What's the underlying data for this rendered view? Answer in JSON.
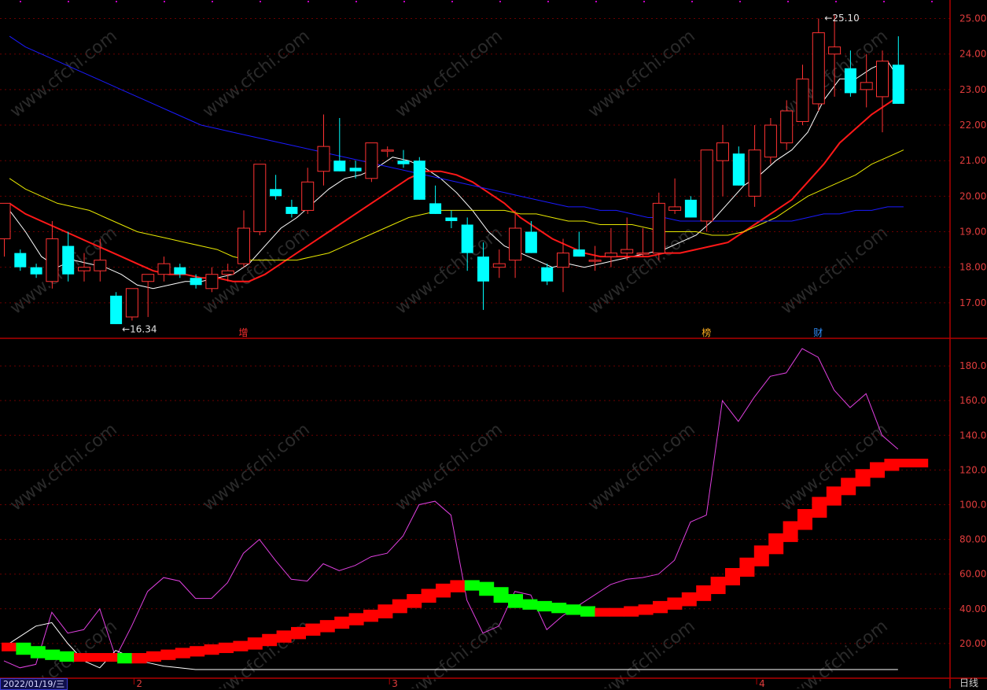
{
  "chart_data": [
    {
      "panel": "price",
      "type": "candlestick",
      "y_axis_ticks": [
        "25.00",
        "24.00",
        "23.00",
        "22.00",
        "21.00",
        "20.00",
        "19.00",
        "18.00",
        "17.00"
      ],
      "ylim": [
        16.0,
        25.3
      ],
      "candles": [
        {
          "o": 18.8,
          "h": 19.7,
          "l": 18.3,
          "c": 19.8
        },
        {
          "o": 18.4,
          "h": 18.5,
          "l": 17.9,
          "c": 18.0
        },
        {
          "o": 18.0,
          "h": 18.1,
          "l": 17.7,
          "c": 17.8
        },
        {
          "o": 17.6,
          "h": 19.3,
          "l": 17.4,
          "c": 18.8
        },
        {
          "o": 18.6,
          "h": 19.0,
          "l": 17.6,
          "c": 17.8
        },
        {
          "o": 17.9,
          "h": 18.4,
          "l": 17.6,
          "c": 18.0
        },
        {
          "o": 17.9,
          "h": 18.8,
          "l": 17.6,
          "c": 18.2
        },
        {
          "o": 17.2,
          "h": 17.3,
          "l": 16.4,
          "c": 16.4
        },
        {
          "o": 16.6,
          "h": 17.4,
          "l": 16.5,
          "c": 17.4
        },
        {
          "o": 17.6,
          "h": 17.8,
          "l": 16.6,
          "c": 17.8
        },
        {
          "o": 17.8,
          "h": 18.3,
          "l": 17.6,
          "c": 18.1
        },
        {
          "o": 18.0,
          "h": 18.1,
          "l": 17.7,
          "c": 17.8
        },
        {
          "o": 17.7,
          "h": 17.8,
          "l": 17.4,
          "c": 17.5
        },
        {
          "o": 17.4,
          "h": 18.0,
          "l": 17.3,
          "c": 17.8
        },
        {
          "o": 17.8,
          "h": 18.1,
          "l": 17.6,
          "c": 17.9
        },
        {
          "o": 18.1,
          "h": 19.6,
          "l": 18.0,
          "c": 19.1
        },
        {
          "o": 19.0,
          "h": 20.9,
          "l": 18.9,
          "c": 20.9
        },
        {
          "o": 20.2,
          "h": 20.6,
          "l": 19.9,
          "c": 20.0
        },
        {
          "o": 19.7,
          "h": 19.9,
          "l": 19.4,
          "c": 19.5
        },
        {
          "o": 19.6,
          "h": 20.8,
          "l": 19.5,
          "c": 20.4
        },
        {
          "o": 20.7,
          "h": 22.3,
          "l": 20.3,
          "c": 21.4
        },
        {
          "o": 21.0,
          "h": 22.2,
          "l": 20.7,
          "c": 20.7
        },
        {
          "o": 20.8,
          "h": 21.0,
          "l": 20.5,
          "c": 20.7
        },
        {
          "o": 20.5,
          "h": 21.5,
          "l": 20.4,
          "c": 21.5
        },
        {
          "o": 21.3,
          "h": 21.4,
          "l": 21.1,
          "c": 21.3
        },
        {
          "o": 21.0,
          "h": 21.3,
          "l": 20.8,
          "c": 20.9
        },
        {
          "o": 21.0,
          "h": 21.1,
          "l": 19.9,
          "c": 19.9
        },
        {
          "o": 19.8,
          "h": 20.3,
          "l": 19.5,
          "c": 19.5
        },
        {
          "o": 19.4,
          "h": 19.6,
          "l": 19.1,
          "c": 19.3
        },
        {
          "o": 19.2,
          "h": 19.4,
          "l": 17.9,
          "c": 18.4
        },
        {
          "o": 18.3,
          "h": 18.7,
          "l": 16.8,
          "c": 17.6
        },
        {
          "o": 18.0,
          "h": 18.5,
          "l": 17.7,
          "c": 18.1
        },
        {
          "o": 18.2,
          "h": 19.6,
          "l": 17.7,
          "c": 19.1
        },
        {
          "o": 19.0,
          "h": 19.3,
          "l": 18.4,
          "c": 18.4
        },
        {
          "o": 18.0,
          "h": 18.1,
          "l": 17.5,
          "c": 17.6
        },
        {
          "o": 18.0,
          "h": 18.8,
          "l": 17.3,
          "c": 18.4
        },
        {
          "o": 18.5,
          "h": 19.0,
          "l": 18.3,
          "c": 18.3
        },
        {
          "o": 18.2,
          "h": 18.6,
          "l": 17.9,
          "c": 18.2
        },
        {
          "o": 18.3,
          "h": 19.1,
          "l": 18.0,
          "c": 18.4
        },
        {
          "o": 18.4,
          "h": 19.4,
          "l": 18.2,
          "c": 18.5
        },
        {
          "o": 18.4,
          "h": 19.1,
          "l": 18.3,
          "c": 18.4
        },
        {
          "o": 18.4,
          "h": 20.1,
          "l": 18.2,
          "c": 19.8
        },
        {
          "o": 19.6,
          "h": 20.5,
          "l": 19.5,
          "c": 19.7
        },
        {
          "o": 19.9,
          "h": 20.0,
          "l": 19.4,
          "c": 19.4
        },
        {
          "o": 19.3,
          "h": 21.3,
          "l": 19.0,
          "c": 21.3
        },
        {
          "o": 21.0,
          "h": 22.0,
          "l": 20.0,
          "c": 21.5
        },
        {
          "o": 21.2,
          "h": 21.4,
          "l": 20.3,
          "c": 20.3
        },
        {
          "o": 20.0,
          "h": 22.0,
          "l": 19.7,
          "c": 21.3
        },
        {
          "o": 21.1,
          "h": 22.2,
          "l": 20.9,
          "c": 22.0
        },
        {
          "o": 21.5,
          "h": 22.7,
          "l": 21.3,
          "c": 22.4
        },
        {
          "o": 22.1,
          "h": 23.7,
          "l": 22.0,
          "c": 23.3
        },
        {
          "o": 22.6,
          "h": 25.0,
          "l": 22.4,
          "c": 24.6
        },
        {
          "o": 24.0,
          "h": 25.1,
          "l": 22.8,
          "c": 24.2
        },
        {
          "o": 23.6,
          "h": 24.1,
          "l": 22.8,
          "c": 22.9
        },
        {
          "o": 23.0,
          "h": 24.0,
          "l": 22.5,
          "c": 23.2
        },
        {
          "o": 22.8,
          "h": 24.1,
          "l": 21.8,
          "c": 23.8
        },
        {
          "o": 23.7,
          "h": 24.5,
          "l": 22.6,
          "c": 22.6
        }
      ],
      "ma_lines": [
        {
          "color": "#ffffff",
          "values": [
            19.6,
            19.0,
            18.3,
            18.0,
            18.2,
            18.1,
            18.0,
            17.8,
            17.5,
            17.4,
            17.5,
            17.6,
            17.6,
            17.7,
            17.8,
            18.1,
            18.6,
            19.1,
            19.4,
            19.8,
            20.2,
            20.5,
            20.6,
            20.8,
            21.1,
            21.0,
            20.8,
            20.5,
            20.1,
            19.6,
            19.0,
            18.6,
            18.4,
            18.2,
            18.0,
            18.1,
            18.0,
            18.1,
            18.2,
            18.3,
            18.4,
            18.5,
            18.7,
            18.9,
            19.3,
            19.8,
            20.3,
            20.6,
            21.0,
            21.3,
            21.8,
            22.7,
            23.3,
            23.3,
            23.6,
            23.8,
            23.1
          ]
        },
        {
          "color": "#ff1818",
          "values": [
            19.8,
            19.5,
            19.3,
            19.1,
            18.9,
            18.7,
            18.5,
            18.3,
            18.1,
            17.9,
            17.8,
            17.8,
            17.7,
            17.7,
            17.6,
            17.6,
            17.8,
            18.1,
            18.4,
            18.7,
            19.0,
            19.3,
            19.6,
            19.9,
            20.2,
            20.5,
            20.7,
            20.7,
            20.6,
            20.4,
            20.1,
            19.8,
            19.4,
            19.1,
            18.8,
            18.6,
            18.4,
            18.3,
            18.3,
            18.3,
            18.3,
            18.4,
            18.4,
            18.5,
            18.6,
            18.7,
            19.0,
            19.3,
            19.6,
            19.9,
            20.4,
            20.9,
            21.5,
            21.9,
            22.3,
            22.6,
            22.9
          ]
        },
        {
          "color": "#e8e800",
          "values": [
            20.5,
            20.2,
            20.0,
            19.8,
            19.7,
            19.6,
            19.4,
            19.2,
            19.0,
            18.9,
            18.8,
            18.7,
            18.6,
            18.5,
            18.3,
            18.2,
            18.2,
            18.2,
            18.2,
            18.3,
            18.4,
            18.6,
            18.8,
            19.0,
            19.2,
            19.4,
            19.5,
            19.6,
            19.6,
            19.6,
            19.6,
            19.6,
            19.5,
            19.5,
            19.4,
            19.3,
            19.3,
            19.2,
            19.2,
            19.2,
            19.1,
            19.0,
            19.0,
            19.0,
            18.9,
            18.9,
            19.0,
            19.2,
            19.4,
            19.7,
            20.0,
            20.2,
            20.4,
            20.6,
            20.9,
            21.1,
            21.3
          ]
        },
        {
          "color": "#1a1aff",
          "values": [
            24.5,
            24.2,
            24.0,
            23.8,
            23.6,
            23.4,
            23.2,
            23.0,
            22.8,
            22.6,
            22.4,
            22.2,
            22.0,
            21.9,
            21.8,
            21.7,
            21.6,
            21.5,
            21.4,
            21.3,
            21.2,
            21.1,
            21.0,
            20.9,
            20.8,
            20.7,
            20.6,
            20.5,
            20.4,
            20.3,
            20.2,
            20.1,
            20.0,
            19.9,
            19.8,
            19.7,
            19.7,
            19.6,
            19.6,
            19.5,
            19.4,
            19.4,
            19.3,
            19.3,
            19.3,
            19.3,
            19.3,
            19.3,
            19.3,
            19.3,
            19.4,
            19.5,
            19.5,
            19.6,
            19.6,
            19.7,
            19.7
          ]
        }
      ],
      "annotations": [
        {
          "text": "16.34",
          "index": 7,
          "value": 16.34,
          "color": "#e0e0e0"
        },
        {
          "text": "25.10",
          "index": 51,
          "value": 25.1,
          "color": "#e0e0e0"
        }
      ],
      "event_markers": [
        {
          "text": "增",
          "index": 15,
          "color": "#ff3030"
        },
        {
          "text": "榜",
          "index": 44,
          "color": "#ffb020"
        },
        {
          "text": "财",
          "index": 51,
          "color": "#3090ff"
        }
      ]
    },
    {
      "panel": "indicator",
      "type": "line",
      "y_axis_ticks": [
        "180.00",
        "160.00",
        "140.00",
        "120.00",
        "100.00",
        "80.00",
        "60.00",
        "40.00",
        "20.00"
      ],
      "ylim": [
        0,
        195
      ],
      "series": [
        {
          "color": "#e040e0",
          "values": [
            10,
            6,
            8,
            38,
            26,
            28,
            40,
            12,
            30,
            50,
            58,
            56,
            46,
            46,
            55,
            72,
            80,
            68,
            57,
            56,
            66,
            62,
            65,
            70,
            72,
            82,
            100,
            102,
            94,
            45,
            26,
            30,
            50,
            48,
            28,
            36,
            42,
            48,
            54,
            57,
            58,
            60,
            68,
            90,
            94,
            160,
            148,
            162,
            174,
            176,
            190,
            185,
            166,
            156,
            164,
            140,
            132
          ]
        },
        {
          "color": "#ffffff",
          "values": [
            18,
            24,
            30,
            32,
            20,
            10,
            6,
            16,
            12,
            9,
            7,
            6,
            5,
            5,
            5,
            5,
            5,
            5,
            5,
            5,
            5,
            5,
            5,
            5,
            5,
            5,
            5,
            5,
            5,
            5,
            5,
            5,
            5,
            5,
            5,
            5,
            5,
            5,
            5,
            5,
            5,
            5,
            5,
            5,
            5,
            5,
            5,
            5,
            5,
            5,
            5,
            5,
            5,
            5,
            5,
            5,
            5
          ]
        },
        {
          "type": "step",
          "up_color": "#ff0000",
          "down_color": "#00ff00",
          "values": [
            18,
            16,
            14,
            13,
            12,
            12,
            12,
            12,
            11,
            12,
            13,
            14,
            15,
            16,
            17,
            18,
            19,
            21,
            23,
            25,
            27,
            29,
            31,
            33,
            35,
            37,
            40,
            43,
            46,
            49,
            52,
            54,
            53,
            50,
            46,
            43,
            42,
            41,
            40,
            39,
            38,
            38,
            38,
            39,
            40,
            42,
            44,
            47,
            51,
            56,
            61,
            67,
            74,
            81,
            88,
            95,
            102,
            108,
            113,
            118,
            122,
            124,
            124,
            124
          ]
        }
      ]
    }
  ],
  "x_axis": {
    "date_label": "2022/01/19/三",
    "month_ticks": [
      {
        "label": "2",
        "index": 8
      },
      {
        "label": "3",
        "index": 24
      },
      {
        "label": "4",
        "index": 47
      }
    ],
    "period_label": "日线"
  },
  "watermark": "www.cfchi.com",
  "colors": {
    "up": "#ff3232",
    "down": "#00ffff",
    "axis": "#b00000",
    "grid": "#6a0000",
    "tick_text": "#e03c3c"
  }
}
